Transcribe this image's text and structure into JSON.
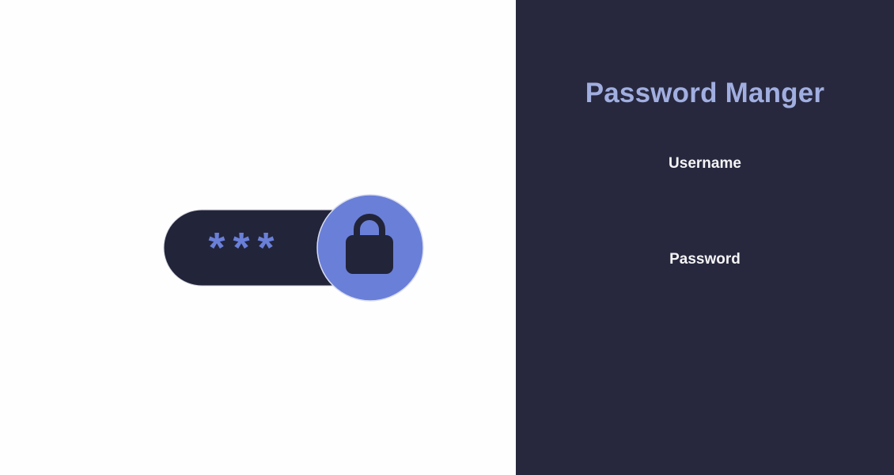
{
  "illustration": {
    "masked_text": "***",
    "icon": "lock-icon",
    "colors": {
      "pill": "#22243a",
      "accent": "#6a7fd8",
      "lock": "#22243a"
    }
  },
  "login_panel": {
    "title": "Password Manger",
    "username_label": "Username",
    "password_label": "Password",
    "colors": {
      "background": "#27283e",
      "title": "#a1aee0",
      "label": "#f4f4f6"
    }
  }
}
